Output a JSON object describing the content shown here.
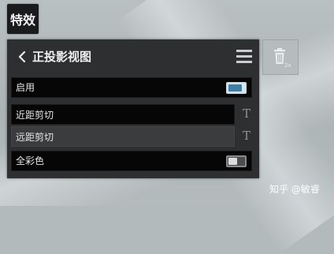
{
  "tab": {
    "label": "特效"
  },
  "panel": {
    "title": "正投影视图",
    "back_icon": "chevron-left-icon",
    "menu_icon": "hamburger-menu-icon",
    "rows": {
      "enable": {
        "label": "启用",
        "toggle_state": "on"
      },
      "near_clip": {
        "value": "近距剪切",
        "t_icon": "T"
      },
      "far_clip": {
        "value": "远距剪切",
        "t_icon": "T"
      },
      "full_color": {
        "label": "全彩色",
        "toggle_state": "off"
      }
    }
  },
  "trash": {
    "icon": "trash-icon",
    "badge": "2x"
  },
  "watermark": {
    "text": "知乎 @敏睿"
  },
  "colors": {
    "panel_bg": "#2d2f31",
    "row_bg": "#060606",
    "toggle_on_accent": "#3f7ea6",
    "page_bg": "#b3babc"
  }
}
